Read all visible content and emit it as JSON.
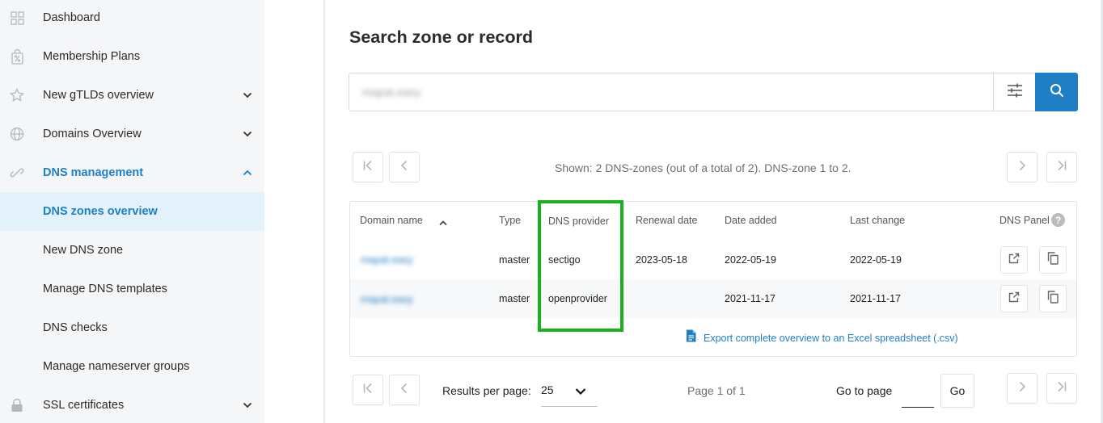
{
  "sidebar": {
    "items": [
      {
        "label": "Dashboard",
        "icon": "grid-icon"
      },
      {
        "label": "Membership Plans",
        "icon": "percent-bag-icon"
      },
      {
        "label": "New gTLDs overview",
        "icon": "star-icon",
        "chevron": "down"
      },
      {
        "label": "Domains Overview",
        "icon": "globe-icon",
        "chevron": "down"
      },
      {
        "label": "DNS management",
        "icon": "link-icon",
        "chevron": "up",
        "state": "expanded"
      },
      {
        "label": "DNS zones overview",
        "state": "selected"
      },
      {
        "label": "New DNS zone"
      },
      {
        "label": "Manage DNS templates"
      },
      {
        "label": "DNS checks"
      },
      {
        "label": "Manage nameserver groups"
      },
      {
        "label": "SSL certificates",
        "icon": "lock-icon",
        "chevron": "down"
      }
    ]
  },
  "main": {
    "title": "Search zone or record",
    "search": {
      "value": "mapat.easy",
      "placeholder": ""
    },
    "shown_text": "Shown: 2 DNS-zones (out of a total of 2). DNS-zone 1 to 2.",
    "table": {
      "columns": [
        "Domain name",
        "Type",
        "DNS provider",
        "Renewal date",
        "Date added",
        "Last change",
        "DNS Panel"
      ],
      "rows": [
        {
          "domain": "mapat.easy",
          "type": "master",
          "provider": "sectigo",
          "renewal": "2023-05-18",
          "added": "2022-05-19",
          "changed": "2022-05-19"
        },
        {
          "domain": "mapat.easy",
          "type": "master",
          "provider": "openprovider",
          "renewal": "",
          "added": "2021-11-17",
          "changed": "2021-11-17"
        }
      ],
      "help_glyph": "?",
      "export_label": "Export complete overview to an Excel spreadsheet (.csv)"
    },
    "footer": {
      "results_per_page_label": "Results per page:",
      "results_per_page_value": "25",
      "page_info": "Page 1 of 1",
      "goto_label": "Go to page",
      "go_label": "Go"
    }
  },
  "colors": {
    "accent": "#1f7fc4",
    "sidebar_bg": "#f5f6f8",
    "selected_bg": "#e3f1fb",
    "highlight": "#19b21c"
  }
}
